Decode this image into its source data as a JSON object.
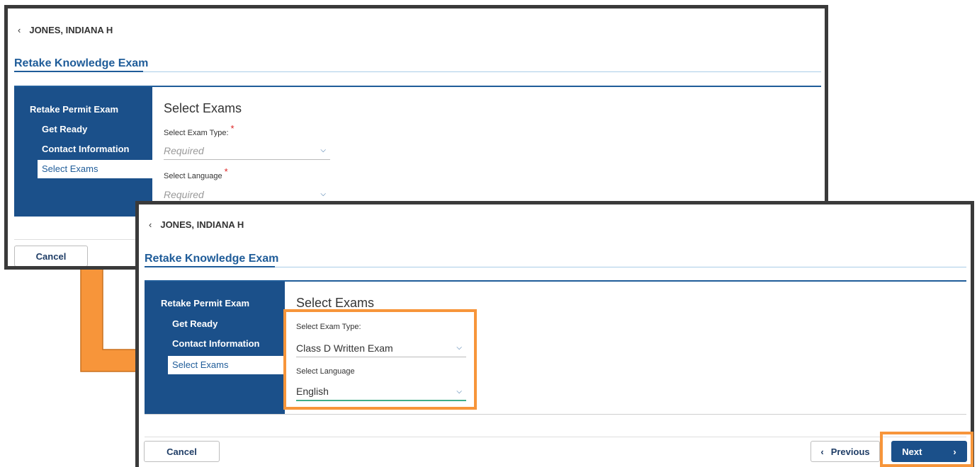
{
  "screens": [
    {
      "back_label": "JONES, INDIANA H",
      "page_title": "Retake Knowledge Exam",
      "sidebar": {
        "heading": "Retake Permit Exam",
        "items": [
          {
            "label": "Get Ready"
          },
          {
            "label": "Contact Information"
          },
          {
            "label": "Select Exams"
          }
        ]
      },
      "section_title": "Select Exams",
      "exam_type": {
        "label": "Select Exam Type:",
        "required_mark": "*",
        "value": "Required"
      },
      "language": {
        "label": "Select Language",
        "required_mark": "*",
        "value": "Required"
      },
      "footer": {
        "cancel_label": "Cancel"
      }
    },
    {
      "back_label": "JONES, INDIANA H",
      "page_title": "Retake Knowledge Exam",
      "sidebar": {
        "heading": "Retake Permit Exam",
        "items": [
          {
            "label": "Get Ready"
          },
          {
            "label": "Contact Information"
          },
          {
            "label": "Select Exams"
          }
        ]
      },
      "section_title": "Select Exams",
      "exam_type": {
        "label": "Select Exam Type:",
        "value": "Class D Written Exam"
      },
      "language": {
        "label": "Select Language",
        "value": "English"
      },
      "footer": {
        "cancel_label": "Cancel",
        "previous_label": "Previous",
        "next_label": "Next"
      }
    }
  ],
  "icons": {
    "back": "chevron-left-icon",
    "dropdown": "chevron-down-icon",
    "previous": "chevron-left-icon",
    "next": "chevron-right-icon"
  },
  "colors": {
    "brand_blue": "#1b508a",
    "link_blue": "#1f5c99",
    "highlight_orange": "#f7953a",
    "required_red": "#dd2222",
    "focus_green": "#3fae8a"
  }
}
